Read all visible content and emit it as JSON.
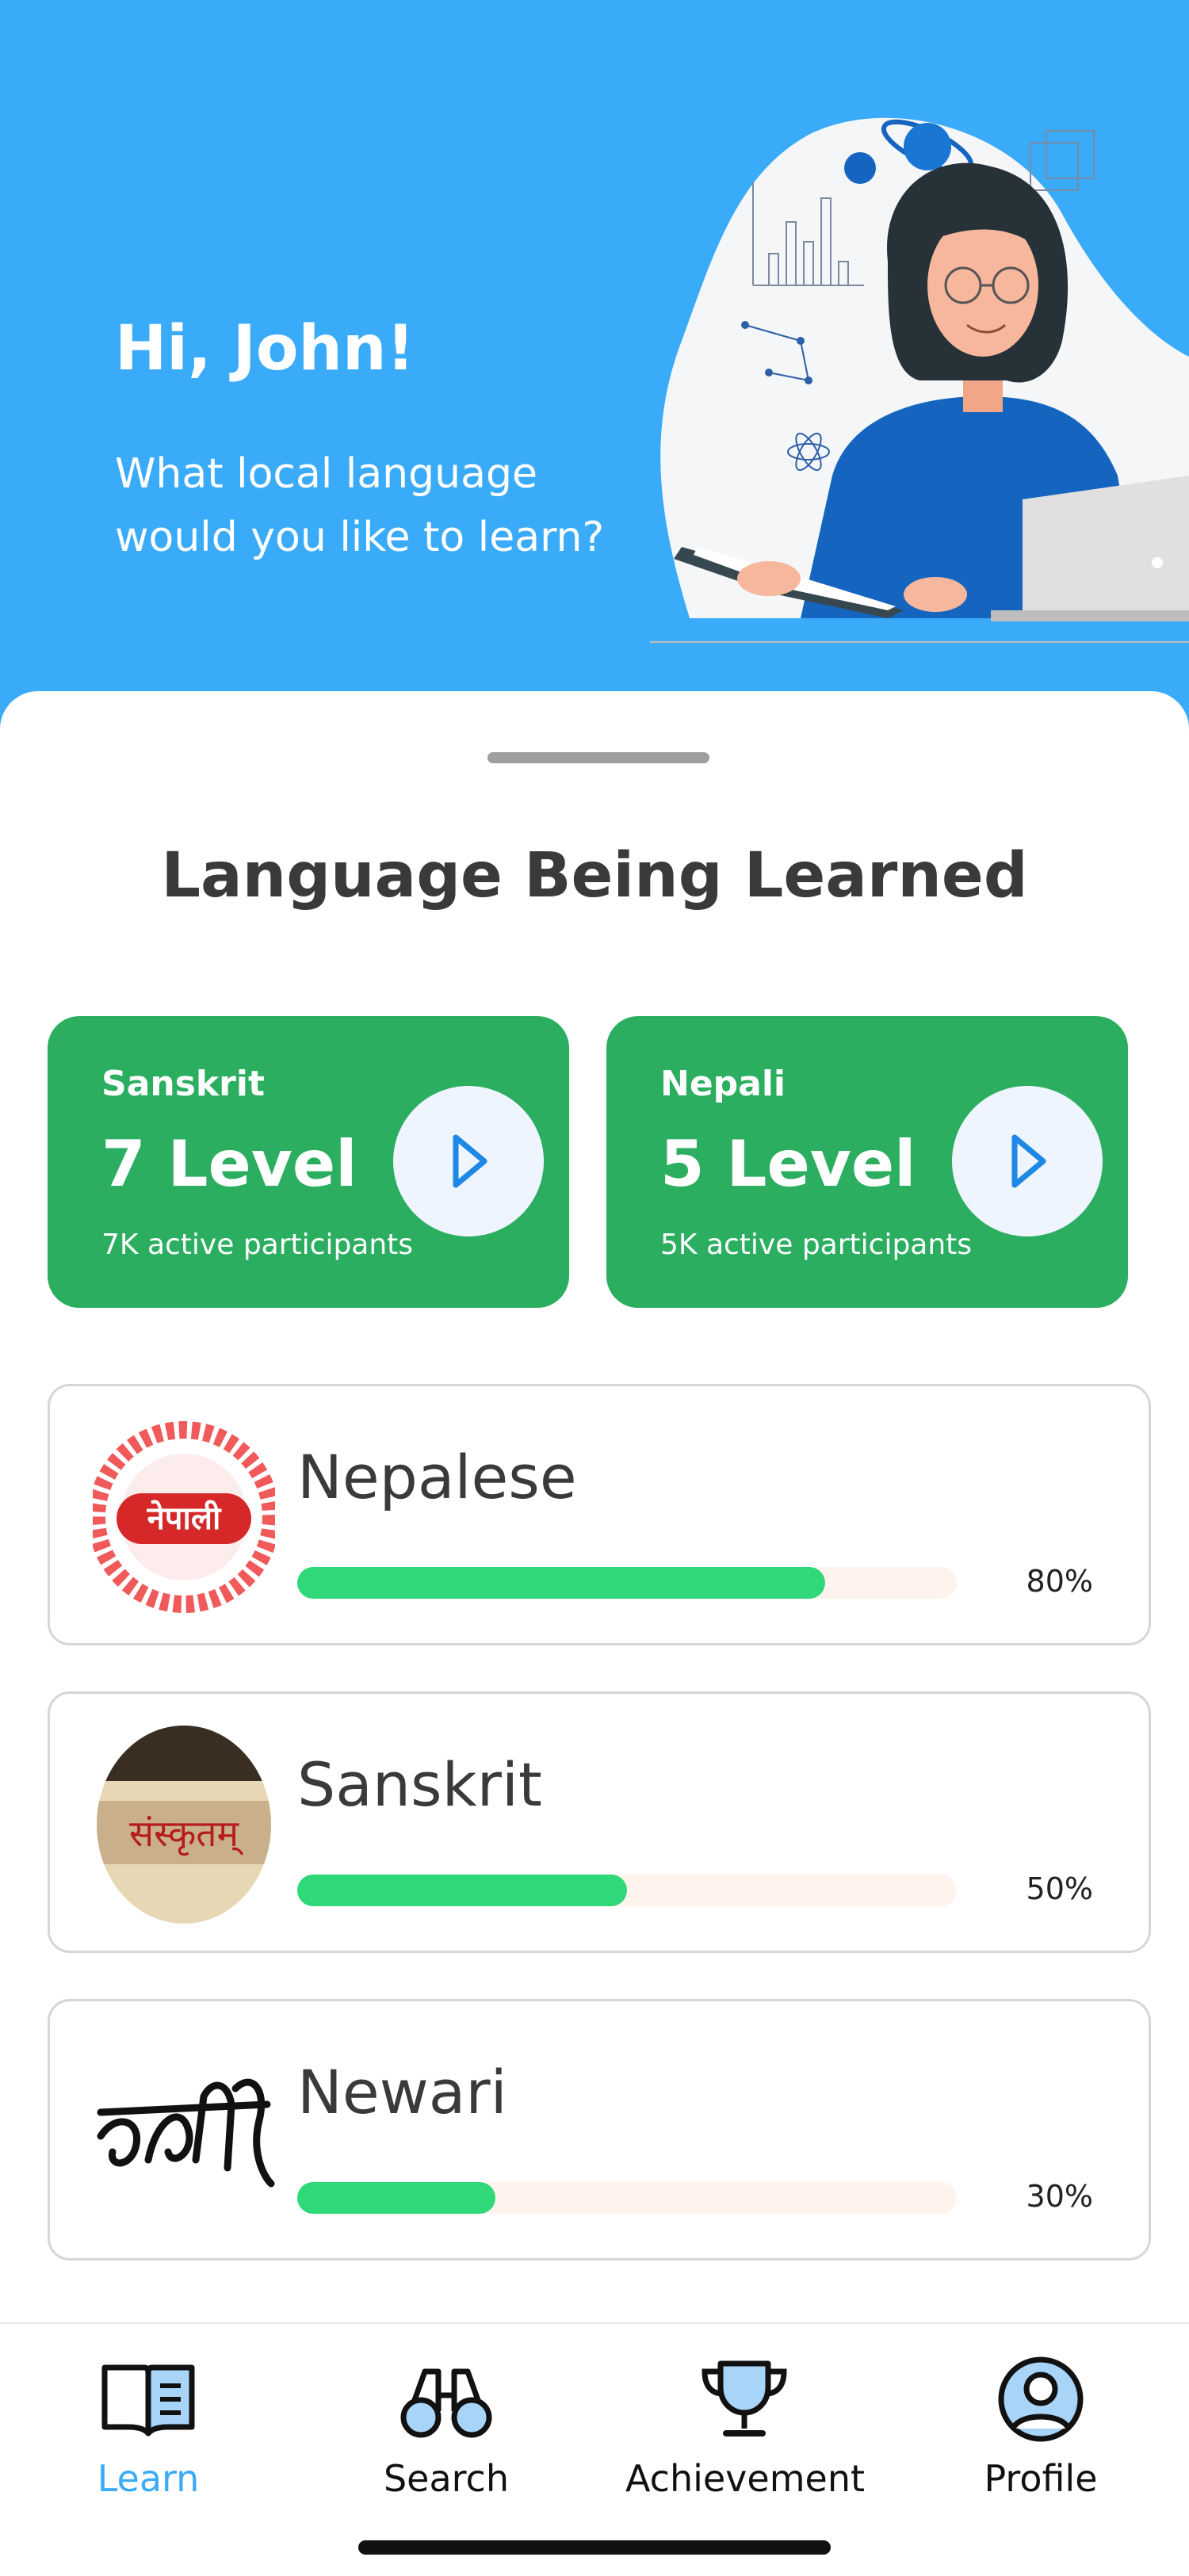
{
  "header": {
    "greeting": "Hi, John!",
    "subtitle": "What local language would you like to learn?",
    "background_color": "#3AABF9"
  },
  "section_title": "Language Being Learned",
  "current_courses": [
    {
      "name": "Sanskrit",
      "level": "7 Level",
      "participants": "7K active participants",
      "action_icon": "play-icon"
    },
    {
      "name": "Nepali",
      "level": "5 Level",
      "participants": "5K active participants",
      "action_icon": "play-icon"
    }
  ],
  "languages": [
    {
      "name": "Nepalese",
      "progress_label": "80%",
      "progress": 0.8,
      "thumb_text": "नेपाली"
    },
    {
      "name": "Sanskrit",
      "progress_label": "50%",
      "progress": 0.5,
      "thumb_text": "संस्कृतम्"
    },
    {
      "name": "Newari",
      "progress_label": "30%",
      "progress": 0.3,
      "thumb_text": "ᨅᨀᨊᨒ"
    }
  ],
  "nav": [
    {
      "label": "Learn",
      "icon": "book-icon",
      "active": true
    },
    {
      "label": "Search",
      "icon": "binoculars-icon",
      "active": false
    },
    {
      "label": "Achievement",
      "icon": "trophy-icon",
      "active": false
    },
    {
      "label": "Profile",
      "icon": "profile-icon",
      "active": false
    }
  ],
  "colors": {
    "accent": "#3AABF9",
    "card_green": "#2BAE60",
    "progress_green": "#2FD97A",
    "progress_track": "#FFF3EE"
  }
}
